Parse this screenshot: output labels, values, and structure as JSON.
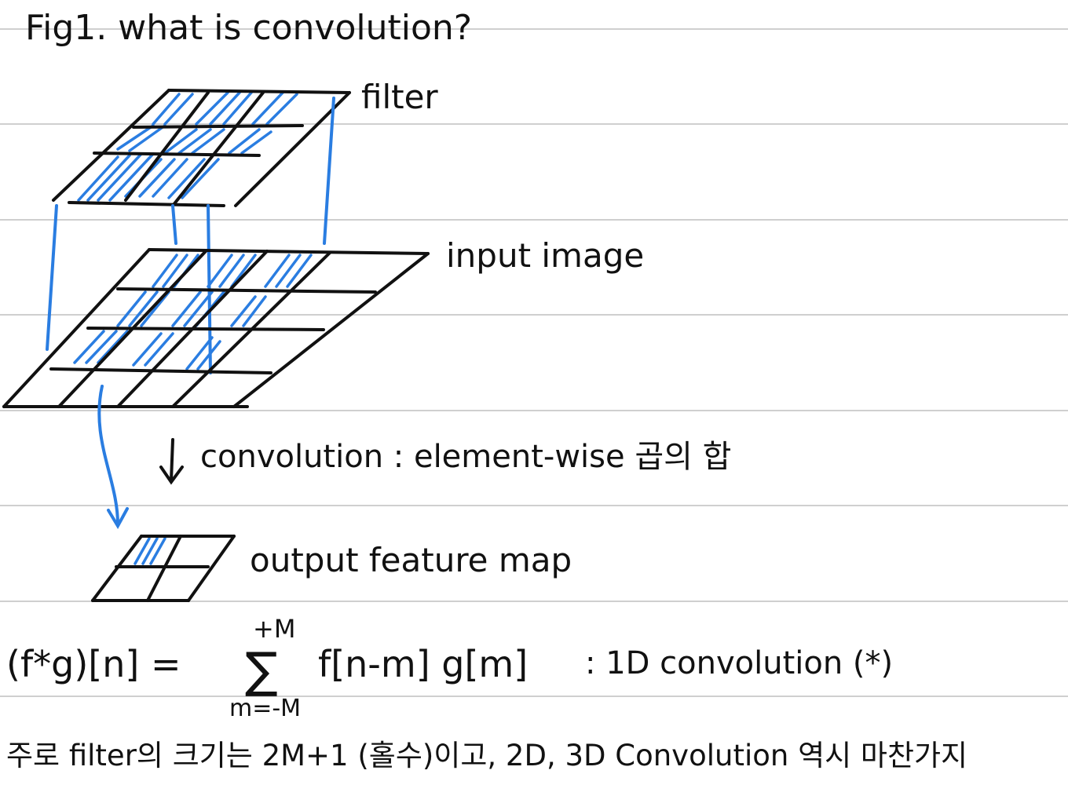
{
  "title": "Fig1. what is convolution?",
  "labels": {
    "filter": "filter",
    "input_image": "input image",
    "output_feature_map": "output feature map"
  },
  "convolution_note": "convolution : element-wise 곱의 합",
  "formula": {
    "lhs": "(f*g)[n] =",
    "sum_upper": "+M",
    "sum_symbol": "∑",
    "sum_lower": "m=-M",
    "rhs": "f[n-m] g[m]",
    "note": ": 1D convolution (*)"
  },
  "footer_note": "주로 filter의 크기는 2M+1 (홀수)이고, 2D, 3D Convolution 역시 마찬가지",
  "colors": {
    "ink": "#111111",
    "highlight": "#2a7de1",
    "rule_lines": "#cfcfcf"
  }
}
